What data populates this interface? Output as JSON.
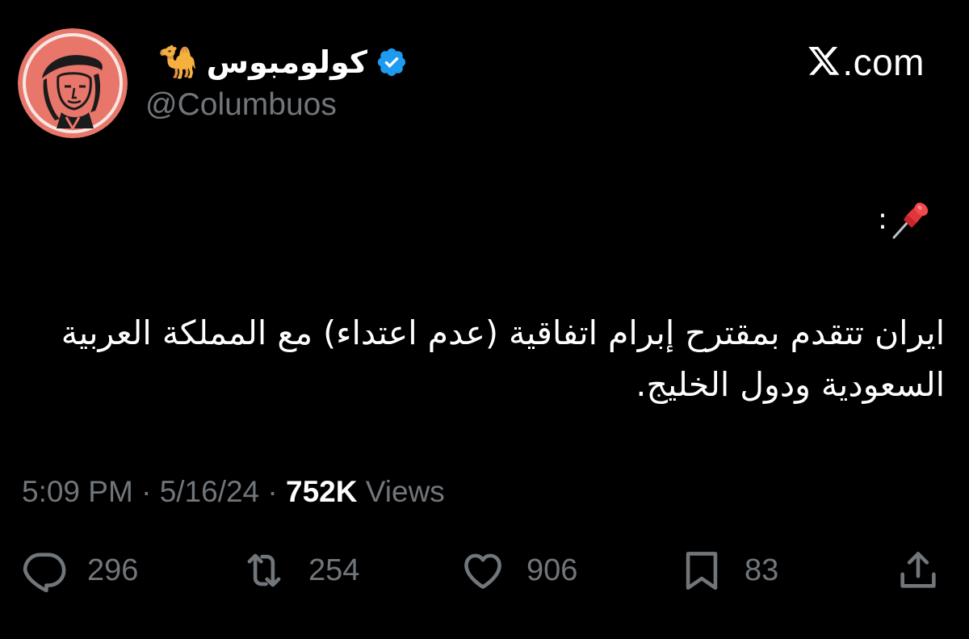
{
  "author": {
    "display_name": "كولومبوس",
    "name_emoji": "🐪",
    "handle": "@Columbuos",
    "verified": true,
    "avatar_icon": "columbus-portrait-avatar"
  },
  "brand": {
    "text": ".com",
    "icon": "x-logo-icon"
  },
  "tweet": {
    "pin_prefix": ":",
    "pin_icon": "pushpin-icon",
    "text": "ايران تتقدم بمقترح إبرام اتفاقية (عدم اعتداء) مع المملكة العربية السعودية ودول الخليج."
  },
  "meta": {
    "time": "5:09 PM",
    "separator": "·",
    "date": "5/16/24",
    "views_count": "752K",
    "views_label": "Views"
  },
  "actions": {
    "replies": "296",
    "reposts": "254",
    "likes": "906",
    "bookmarks": "83"
  },
  "colors": {
    "background": "#000000",
    "primary_text": "#ffffff",
    "secondary_text": "#71767b",
    "verified_blue": "#1d9bf0",
    "avatar_bg": "#e8766a"
  }
}
